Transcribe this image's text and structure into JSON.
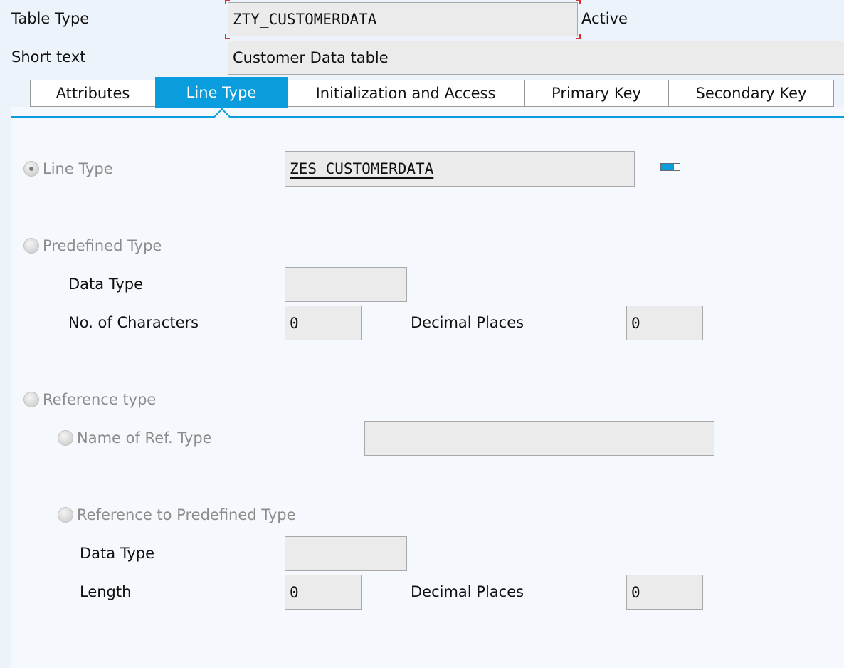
{
  "header": {
    "table_type_label": "Table Type",
    "table_type_value": "ZTY_CUSTOMERDATA",
    "status": "Active",
    "short_text_label": "Short text",
    "short_text_value": "Customer Data table"
  },
  "tabs": [
    {
      "label": "Attributes",
      "active": false
    },
    {
      "label": "Line Type",
      "active": true
    },
    {
      "label": "Initialization and Access",
      "active": false
    },
    {
      "label": "Primary Key",
      "active": false
    },
    {
      "label": "Secondary Key",
      "active": false
    }
  ],
  "line_type": {
    "radio_label": "Line Type",
    "selected": true,
    "value": "ZES_CUSTOMERDATA"
  },
  "predefined_type": {
    "radio_label": "Predefined Type",
    "data_type_label": "Data Type",
    "data_type_value": "",
    "no_chars_label": "No. of Characters",
    "no_chars_value": "0",
    "decimal_label": "Decimal Places",
    "decimal_value": "0"
  },
  "reference_type": {
    "radio_label": "Reference type",
    "name_ref_label": "Name of Ref. Type",
    "name_ref_value": "",
    "ref_predef_label": "Reference to Predefined Type",
    "data_type_label": "Data Type",
    "data_type_value": "",
    "length_label": "Length",
    "length_value": "0",
    "decimal_label": "Decimal Places",
    "decimal_value": "0"
  },
  "colors": {
    "accent": "#0a9ddd",
    "focus_corner": "#d93030",
    "panel_bg": "#f5f9fd",
    "page_bg": "#edf3fa"
  }
}
